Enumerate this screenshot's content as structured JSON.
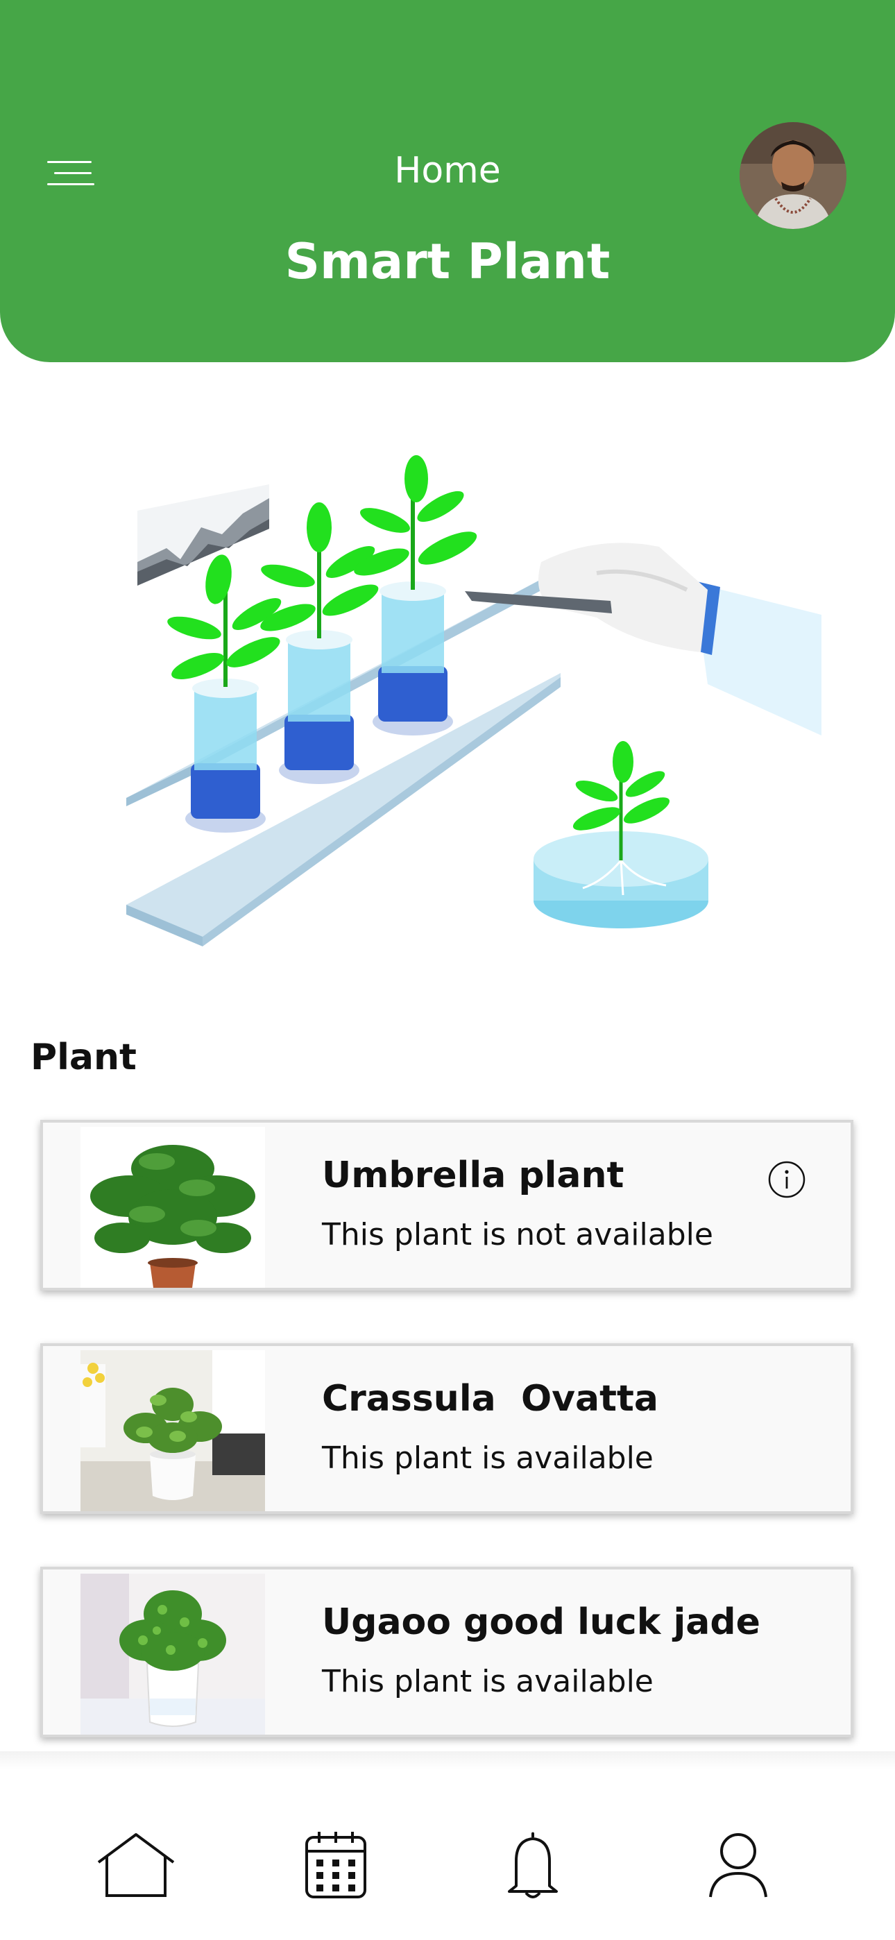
{
  "header": {
    "title": "Home",
    "subtitle": "Smart Plant",
    "background_color": "#46a647",
    "menu_icon": "hamburger-menu-icon",
    "avatar": "user-avatar"
  },
  "section": {
    "title": "Plant"
  },
  "plants": [
    {
      "name": "Umbrella plant",
      "status": "This plant is not available",
      "has_info_icon": true,
      "info_icon": "info-icon"
    },
    {
      "name": "Crassula  Ovatta",
      "status": "This plant is available"
    },
    {
      "name": "Ugaoo good luck jade",
      "status": "This plant is available"
    }
  ],
  "bottom_nav": {
    "items": [
      {
        "icon": "home-icon"
      },
      {
        "icon": "calendar-icon"
      },
      {
        "icon": "bell-icon"
      },
      {
        "icon": "profile-icon"
      }
    ]
  },
  "colors": {
    "accent": "#46a647",
    "leaf": "#22e01e",
    "water": "#7fd6ef",
    "pot_blue": "#2f5fd0"
  }
}
